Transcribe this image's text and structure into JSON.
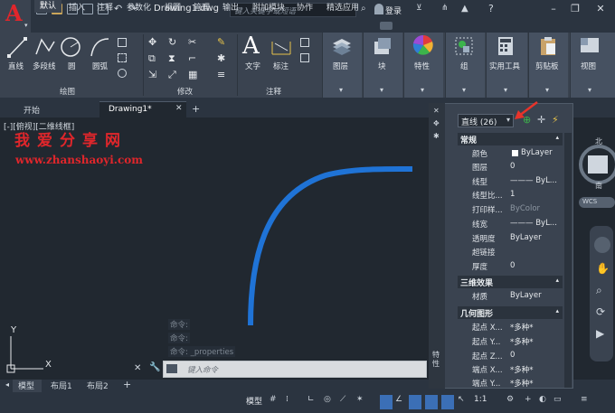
{
  "app": {
    "logo_letter": "A",
    "doc_title": "Drawing1.dwg",
    "search_placeholder": "键入关键字或短语",
    "login": "登录"
  },
  "ribbon_tabs": [
    "默认",
    "插入",
    "注释",
    "参数化",
    "视图",
    "管理",
    "输出",
    "附加模块",
    "协作",
    "精选应用"
  ],
  "ribbon": {
    "draw": {
      "line": "直线",
      "polyline": "多段线",
      "circle": "圆",
      "arc": "圆弧",
      "title": "绘图"
    },
    "modify_title": "修改",
    "annotation": {
      "text": "文字",
      "dim": "标注",
      "title": "注释"
    },
    "layers": "图层",
    "block": "块",
    "properties": "特性",
    "groups": "组",
    "utilities": "实用工具",
    "clipboard": "剪贴板",
    "view": "视图"
  },
  "doc_tabs": {
    "start": "开始",
    "drawing": "Drawing1*"
  },
  "canvas": {
    "viewport_label": "[-][俯视][二维线框]",
    "watermark_cn": "我爱分享网",
    "watermark_url": "www.zhanshaoyi.com",
    "y_axis": "Y",
    "x_axis": "X"
  },
  "command": {
    "history": [
      "命令:",
      "命令:",
      "命令: _properties"
    ],
    "placeholder": "键入命令"
  },
  "layout_tabs": [
    "模型",
    "布局1",
    "布局2"
  ],
  "status": {
    "model": "模型",
    "scale": "1:1"
  },
  "properties_palette": {
    "selection": "直线 (26)",
    "side_title": "特性",
    "groups": [
      {
        "name": "常规",
        "rows": [
          {
            "name": "颜色",
            "value": "ByLayer"
          },
          {
            "name": "图层",
            "value": "0"
          },
          {
            "name": "线型",
            "value": "——— ByL..."
          },
          {
            "name": "线型比...",
            "value": "1"
          },
          {
            "name": "打印样...",
            "value": "ByColor"
          },
          {
            "name": "线宽",
            "value": "——— ByL..."
          },
          {
            "name": "透明度",
            "value": "ByLayer"
          },
          {
            "name": "超链接",
            "value": ""
          },
          {
            "name": "厚度",
            "value": "0"
          }
        ]
      },
      {
        "name": "三维效果",
        "rows": [
          {
            "name": "材质",
            "value": "ByLayer"
          }
        ]
      },
      {
        "name": "几何图形",
        "rows": [
          {
            "name": "起点 X...",
            "value": "*多种*"
          },
          {
            "name": "起点 Y...",
            "value": "*多种*"
          },
          {
            "name": "起点 Z...",
            "value": "0"
          },
          {
            "name": "端点 X...",
            "value": "*多种*"
          },
          {
            "name": "端点 Y...",
            "value": "*多种*"
          }
        ]
      }
    ]
  },
  "viewcube": {
    "north": "北",
    "south": "南",
    "east": "东",
    "wcs": "WCS"
  },
  "colors": {
    "accent": "#3b6fb6",
    "curve": "#1f73d6",
    "brand_red": "#e0262b",
    "arrow_red": "#e8332a"
  }
}
